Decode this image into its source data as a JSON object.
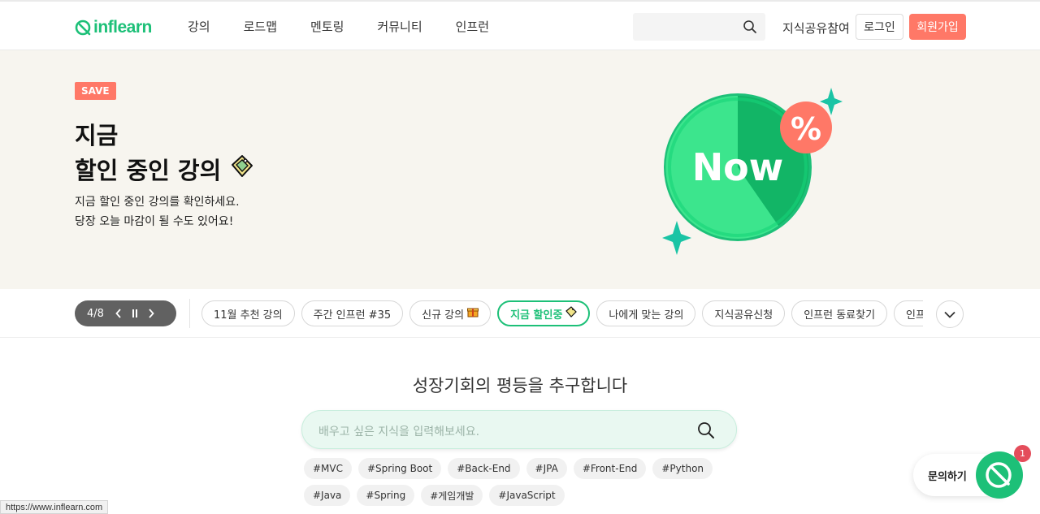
{
  "header": {
    "logo_text": "inflearn",
    "nav": [
      "강의",
      "로드맵",
      "멘토링",
      "커뮤니티",
      "인프런"
    ],
    "search_placeholder": "",
    "share_link": "지식공유참여",
    "login": "로그인",
    "signup": "회원가입"
  },
  "hero": {
    "badge": "SAVE",
    "title_line1": "지금",
    "title_line2": "할인 중인 강의",
    "desc_line1": "지금 할인 중인 강의를 확인하세요.",
    "desc_line2": "당장 오늘 마감이 될 수도 있어요!",
    "art_text": "Now",
    "art_badge": "%",
    "background": "#f7f5ef"
  },
  "strip": {
    "pager": "4/8",
    "chips": [
      {
        "label": "11월 추천 강의",
        "emoji": ""
      },
      {
        "label": "주간 인프런 #35",
        "emoji": ""
      },
      {
        "label": "신규 강의",
        "emoji": "gift-icon"
      },
      {
        "label": "지금 할인중",
        "emoji": "tag-icon"
      },
      {
        "label": "나에게 맞는 강의",
        "emoji": ""
      },
      {
        "label": "지식공유신청",
        "emoji": ""
      },
      {
        "label": "인프런 동료찾기",
        "emoji": ""
      },
      {
        "label": "인프런",
        "emoji": ""
      }
    ],
    "active_index": 3
  },
  "main": {
    "slogan": "성장기회의 평등을 추구합니다",
    "search_placeholder": "배우고 싶은 지식을 입력해보세요.",
    "tags": [
      "#MVC",
      "#Spring Boot",
      "#Back-End",
      "#JPA",
      "#Front-End",
      "#Python",
      "#Java",
      "#Spring",
      "#게임개발",
      "#JavaScript"
    ]
  },
  "floating": {
    "inquiry": "문의하기",
    "badge_count": "1"
  },
  "status_url": "https://www.inflearn.com",
  "colors": {
    "brand": "#1dc078",
    "accent": "#ff7867"
  }
}
